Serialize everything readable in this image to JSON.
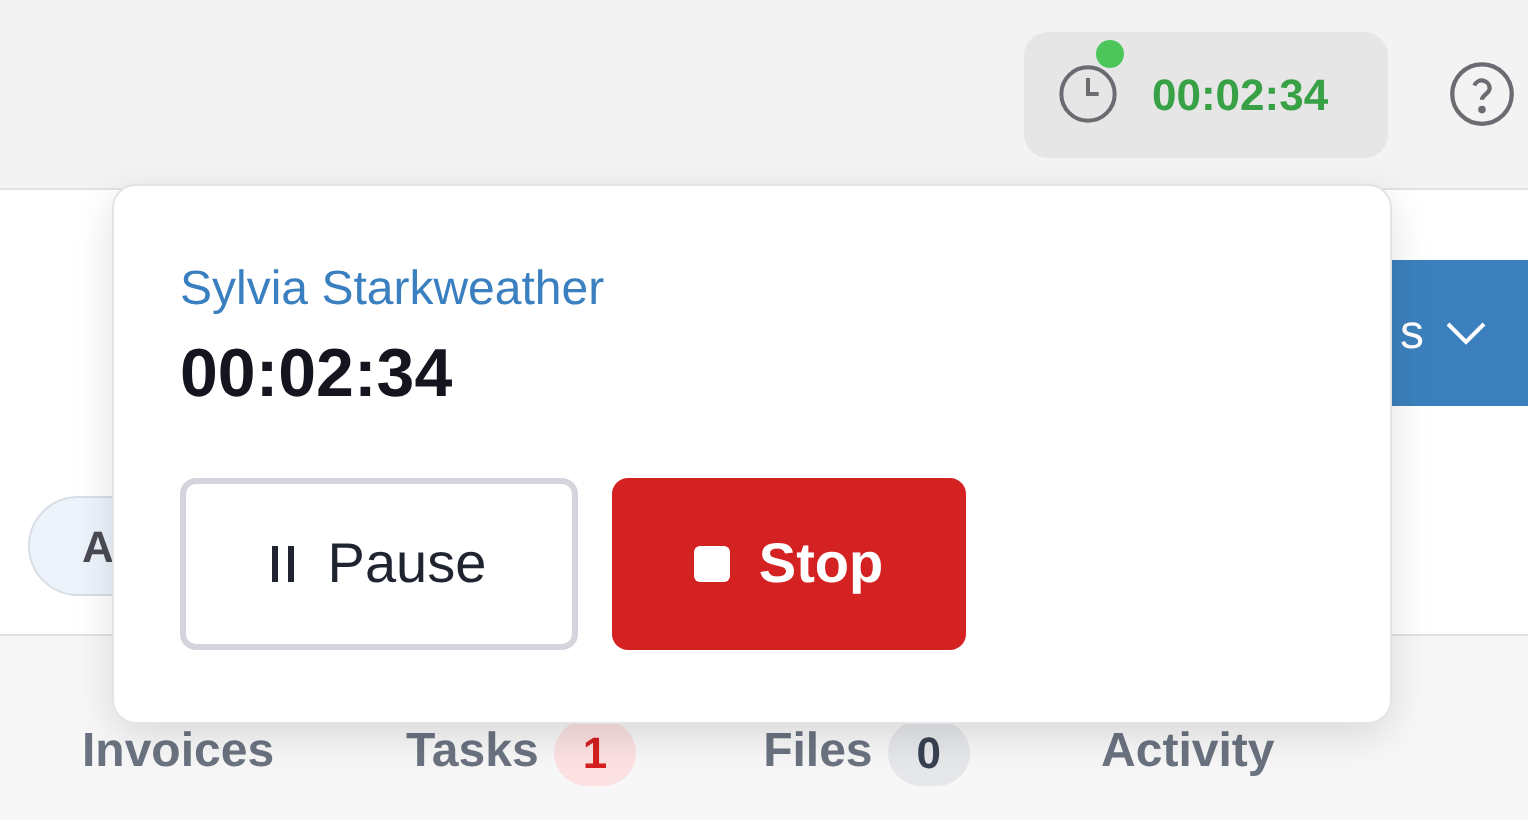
{
  "timer_chip": {
    "time": "00:02:34",
    "running": true
  },
  "action_button": {
    "label": "s"
  },
  "filter_chip": {
    "label": "A"
  },
  "tabs": [
    {
      "label": "Invoices"
    },
    {
      "label": "Tasks",
      "count": "1",
      "kind": "alert"
    },
    {
      "label": "Files",
      "count": "0",
      "kind": "neutral"
    },
    {
      "label": "Activity"
    }
  ],
  "popover": {
    "name": "Sylvia Starkweather",
    "time": "00:02:34",
    "buttons": [
      {
        "label": "Pause",
        "kind": "pause"
      },
      {
        "label": "Stop",
        "kind": "stop"
      }
    ]
  }
}
